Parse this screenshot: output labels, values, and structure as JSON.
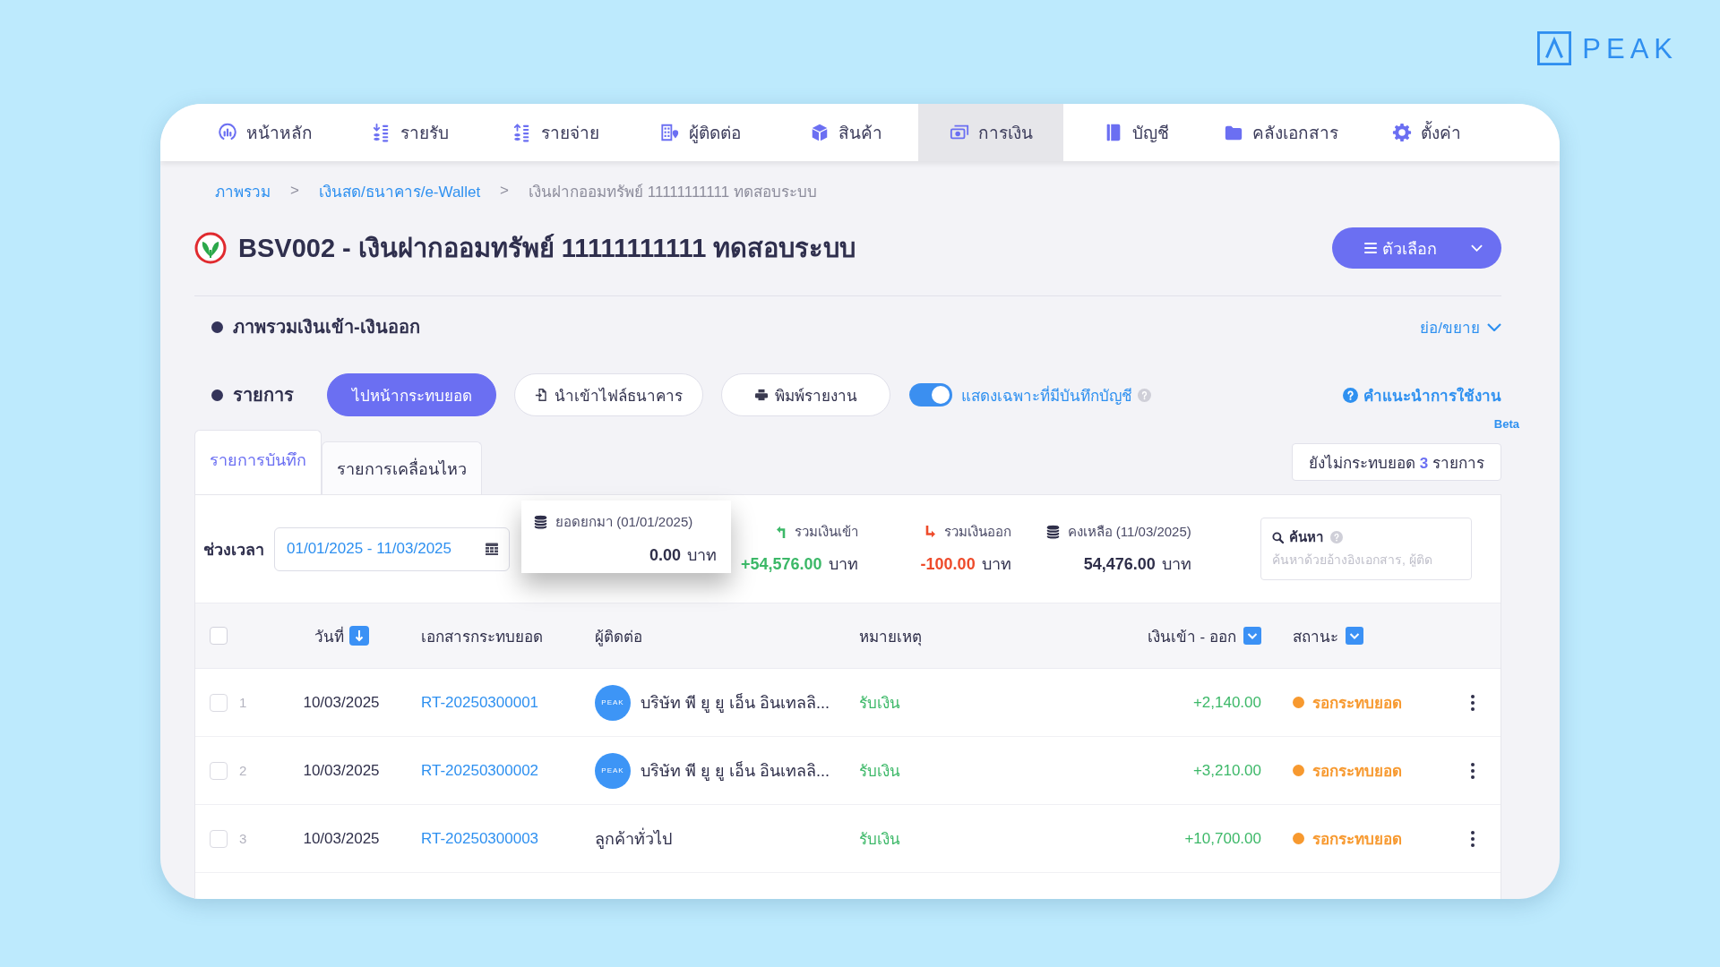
{
  "logo": {
    "text": "PEAK"
  },
  "nav": [
    {
      "label": "หน้าหลัก",
      "selected": false
    },
    {
      "label": "รายรับ",
      "selected": false
    },
    {
      "label": "รายจ่าย",
      "selected": false
    },
    {
      "label": "ผู้ติดต่อ",
      "selected": false
    },
    {
      "label": "สินค้า",
      "selected": false
    },
    {
      "label": "การเงิน",
      "selected": true
    },
    {
      "label": "บัญชี",
      "selected": false
    },
    {
      "label": "คลังเอกสาร",
      "selected": false
    },
    {
      "label": "ตั้งค่า",
      "selected": false
    }
  ],
  "breadcrumb": [
    {
      "kind": "link",
      "text": "ภาพรวม"
    },
    {
      "kind": "separator",
      "text": ">"
    },
    {
      "kind": "link",
      "text": "เงินสด/ธนาคาร/e-Wallet"
    },
    {
      "kind": "separator",
      "text": ">"
    },
    {
      "kind": "current",
      "text": "เงินฝากออมทรัพย์ 11111111111 ทดสอบระบบ"
    }
  ],
  "account": {
    "title": "BSV002 - เงินฝากออมทรัพย์ 11111111111 ทดสอบระบบ",
    "options_button": "ตัวเลือก"
  },
  "overview": {
    "title": "ภาพรวมเงินเข้า-เงินออก",
    "collapse_link": "ย่อ/ขยาย"
  },
  "transactions": {
    "title": "รายการ",
    "buttons": [
      {
        "kind": "primary",
        "label": "ไปหน้ากระทบยอด"
      },
      {
        "kind": "import",
        "label": "นำเข้าไฟล์ธนาคาร"
      },
      {
        "kind": "print",
        "label": "พิมพ์รายงาน"
      }
    ],
    "toggle": {
      "label": "แสดงเฉพาะที่มีบันทึกบัญชี",
      "on": true
    },
    "help": {
      "label": "คำแนะนำการใช้งาน",
      "badge": "Beta"
    }
  },
  "tabs": [
    {
      "label": "รายการบันทึก",
      "selected": true
    },
    {
      "label": "รายการเคลื่อนไหว",
      "selected": false
    }
  ],
  "unreconciled": "ยังไม่กระทบยอด **3** รายการ",
  "filter": {
    "label": "ช่วงเวลา",
    "date_range": "01/01/2025 - 11/03/2025"
  },
  "summary": [
    {
      "kind": "opening",
      "label": "ยอดยกมา (01/01/2025)",
      "amount": "0.00",
      "unit": "บาท"
    },
    {
      "kind": "in",
      "label": "รวมเงินเข้า",
      "amount": "+54,576.00",
      "unit": "บาท"
    },
    {
      "kind": "out",
      "label": "รวมเงินออก",
      "amount": "-100.00",
      "unit": "บาท"
    },
    {
      "kind": "balance",
      "label": "คงเหลือ (11/03/2025)",
      "amount": "54,476.00",
      "unit": "บาท"
    }
  ],
  "search": {
    "label": "ค้นหา",
    "placeholder": "ค้นหาด้วยอ้างอิงเอกสาร, ผู้ติด"
  },
  "table": {
    "select_all": {
      "checked": false
    },
    "columns": [
      {
        "label": "วันที่",
        "kind": "sort"
      },
      {
        "label": "เอกสารกระทบยอด",
        "kind": "plain"
      },
      {
        "label": "ผู้ติดต่อ",
        "kind": "plain"
      },
      {
        "label": "หมายเหตุ",
        "kind": "plain"
      },
      {
        "label": "เงินเข้า - ออก",
        "kind": "filter"
      },
      {
        "label": "สถานะ",
        "kind": "filter"
      }
    ],
    "rows": [
      {
        "checked": false,
        "number": "1",
        "date": "10/03/2025",
        "document": "RT-20250300001",
        "contact": {
          "name": "บริษัท พี ยู ยู เอ็น อินเทลลิ...",
          "avatar": "PEAK"
        },
        "note": "รับเงิน",
        "amount": "+2,140.00",
        "status": {
          "label": "รอกระทบยอด",
          "color": "#f7992f"
        }
      },
      {
        "checked": false,
        "number": "2",
        "date": "10/03/2025",
        "document": "RT-20250300002",
        "contact": {
          "name": "บริษัท พี ยู ยู เอ็น อินเทลลิ...",
          "avatar": "PEAK"
        },
        "note": "รับเงิน",
        "amount": "+3,210.00",
        "status": {
          "label": "รอกระทบยอด",
          "color": "#f7992f"
        }
      },
      {
        "checked": false,
        "number": "3",
        "date": "10/03/2025",
        "document": "RT-20250300003",
        "contact": {
          "name": "ลูกค้าทั่วไป"
        },
        "note": "รับเงิน",
        "amount": "+10,700.00",
        "status": {
          "label": "รอกระทบยอด",
          "color": "#f7992f"
        }
      }
    ]
  }
}
